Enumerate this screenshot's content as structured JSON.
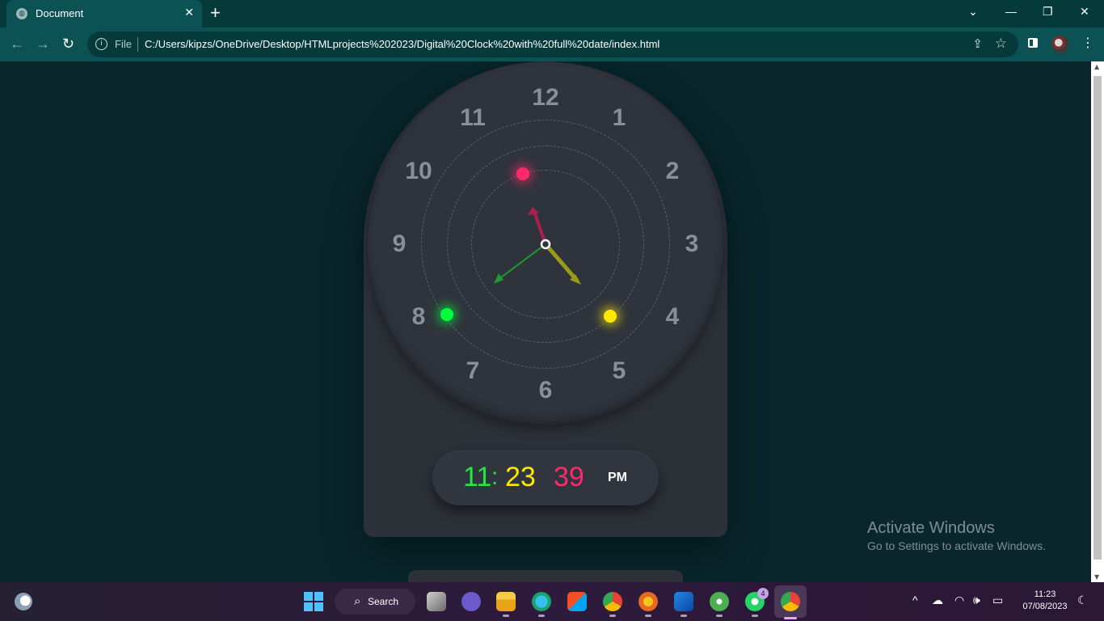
{
  "browser": {
    "tab_title": "Document",
    "tab_close": "✕",
    "new_tab": "+",
    "window_controls": {
      "dropdown": "⌄",
      "minimize": "—",
      "restore": "❐",
      "close": "✕"
    },
    "back": "←",
    "forward": "→",
    "reload": "↻",
    "file_label": "File",
    "url": "C:/Users/kipzs/OneDrive/Desktop/HTMLprojects%202023/Digital%20Clock%20with%20full%20date/index.html",
    "share_icon": "share-icon",
    "star_icon": "☆",
    "menu_icon": "⋮"
  },
  "clock": {
    "numbers": [
      "12",
      "1",
      "2",
      "3",
      "4",
      "5",
      "6",
      "7",
      "8",
      "9",
      "10",
      "11"
    ],
    "colors": {
      "second": "#ff2a6b",
      "minute": "#ffe800",
      "hour": "#00ff3a",
      "body": "#2c3138",
      "background": "#08262b"
    }
  },
  "digital": {
    "hours": "11",
    "colon": ":",
    "minutes": "23",
    "seconds": "39",
    "ampm": "PM"
  },
  "watermark": {
    "line1": "Activate Windows",
    "line2": "Go to Settings to activate Windows."
  },
  "taskbar": {
    "search_label": "Search",
    "whatsapp_badge": "4",
    "time": "11:23",
    "date": "07/08/2023",
    "apps": [
      "task-view",
      "meet",
      "file-explorer",
      "edge",
      "store",
      "chrome",
      "brave",
      "vscode",
      "utorrent",
      "whatsapp",
      "chrome-active"
    ]
  }
}
